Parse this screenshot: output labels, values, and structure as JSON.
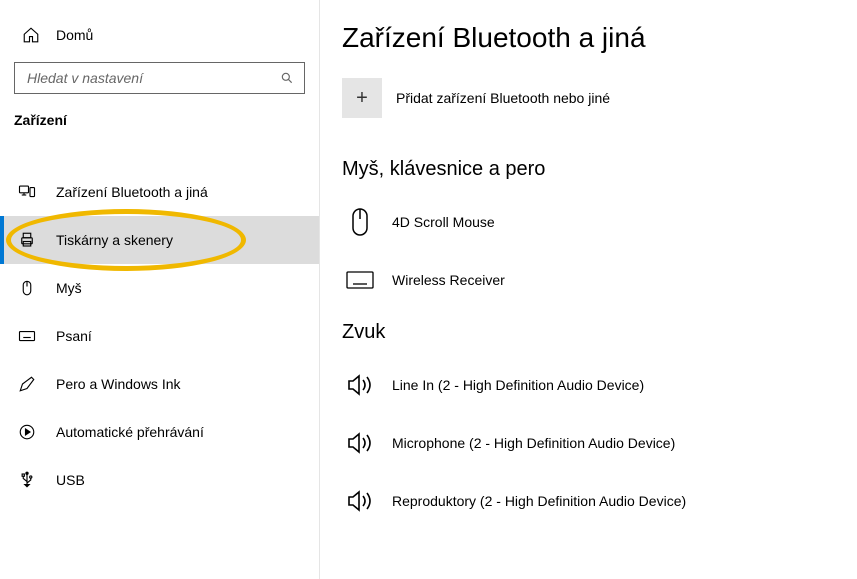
{
  "sidebar": {
    "home_label": "Domů",
    "search_placeholder": "Hledat v nastavení",
    "category_title": "Zařízení",
    "items": [
      {
        "label": "Zařízení Bluetooth a jiná"
      },
      {
        "label": "Tiskárny a skenery"
      },
      {
        "label": "Myš"
      },
      {
        "label": "Psaní"
      },
      {
        "label": "Pero a Windows Ink"
      },
      {
        "label": "Automatické přehrávání"
      },
      {
        "label": "USB"
      }
    ]
  },
  "main": {
    "title": "Zařízení Bluetooth a jiná",
    "add_label": "Přidat zařízení Bluetooth nebo jiné",
    "sections": {
      "mkp_title": "Myš, klávesnice a pero",
      "mkp_items": [
        {
          "label": "4D Scroll Mouse"
        },
        {
          "label": "Wireless Receiver"
        }
      ],
      "audio_title": "Zvuk",
      "audio_items": [
        {
          "label": "Line In (2 - High Definition Audio Device)"
        },
        {
          "label": "Microphone (2 - High Definition Audio Device)"
        },
        {
          "label": "Reproduktory (2 - High Definition Audio Device)"
        }
      ]
    }
  }
}
